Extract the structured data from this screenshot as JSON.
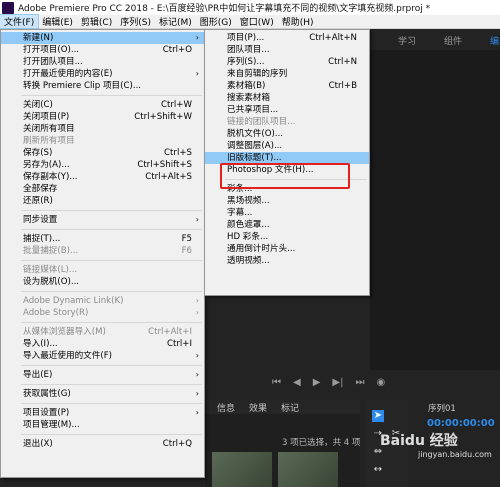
{
  "window": {
    "title": "Adobe Premiere Pro CC 2018 - E:\\百度经验\\PR中如何让字幕填充不同的视频\\文字填充视频.prproj *"
  },
  "menubar": [
    {
      "label": "文件(F)",
      "active": true
    },
    {
      "label": "编辑(E)"
    },
    {
      "label": "剪辑(C)"
    },
    {
      "label": "序列(S)"
    },
    {
      "label": "标记(M)"
    },
    {
      "label": "图形(G)"
    },
    {
      "label": "窗口(W)"
    },
    {
      "label": "帮助(H)"
    }
  ],
  "workspace_tabs": [
    "学习",
    "组件",
    "编"
  ],
  "file_menu": [
    {
      "label": "新建(N)",
      "arrow": true,
      "highlighted": true
    },
    {
      "label": "打开项目(O)...",
      "shortcut": "Ctrl+O"
    },
    {
      "label": "打开团队项目..."
    },
    {
      "label": "打开最近使用的内容(E)",
      "arrow": true
    },
    {
      "label": "转换 Premiere Clip 项目(C)..."
    },
    {
      "sep": true
    },
    {
      "label": "关闭(C)",
      "shortcut": "Ctrl+W"
    },
    {
      "label": "关闭项目(P)",
      "shortcut": "Ctrl+Shift+W"
    },
    {
      "label": "关闭所有项目"
    },
    {
      "label": "刷新所有项目",
      "disabled": true
    },
    {
      "label": "保存(S)",
      "shortcut": "Ctrl+S"
    },
    {
      "label": "另存为(A)...",
      "shortcut": "Ctrl+Shift+S"
    },
    {
      "label": "保存副本(Y)...",
      "shortcut": "Ctrl+Alt+S"
    },
    {
      "label": "全部保存"
    },
    {
      "label": "还原(R)"
    },
    {
      "sep": true
    },
    {
      "label": "同步设置",
      "arrow": true
    },
    {
      "sep": true
    },
    {
      "label": "捕捉(T)...",
      "shortcut": "F5"
    },
    {
      "label": "批量捕捉(B)...",
      "shortcut": "F6",
      "disabled": true
    },
    {
      "sep": true
    },
    {
      "label": "链接媒体(L)...",
      "disabled": true
    },
    {
      "label": "设为脱机(O)..."
    },
    {
      "sep": true
    },
    {
      "label": "Adobe Dynamic Link(K)",
      "arrow": true,
      "disabled": true
    },
    {
      "label": "Adobe Story(R)",
      "arrow": true,
      "disabled": true
    },
    {
      "sep": true
    },
    {
      "label": "从媒体浏览器导入(M)",
      "shortcut": "Ctrl+Alt+I",
      "disabled": true
    },
    {
      "label": "导入(I)...",
      "shortcut": "Ctrl+I"
    },
    {
      "label": "导入最近使用的文件(F)",
      "arrow": true
    },
    {
      "sep": true
    },
    {
      "label": "导出(E)",
      "arrow": true
    },
    {
      "sep": true
    },
    {
      "label": "获取属性(G)",
      "arrow": true
    },
    {
      "sep": true
    },
    {
      "label": "项目设置(P)",
      "arrow": true
    },
    {
      "label": "项目管理(M)..."
    },
    {
      "sep": true
    },
    {
      "label": "退出(X)",
      "shortcut": "Ctrl+Q"
    }
  ],
  "new_submenu": [
    {
      "label": "项目(P)...",
      "shortcut": "Ctrl+Alt+N"
    },
    {
      "label": "团队项目..."
    },
    {
      "label": "序列(S)...",
      "shortcut": "Ctrl+N"
    },
    {
      "label": "来自剪辑的序列"
    },
    {
      "label": "素材箱(B)",
      "shortcut": "Ctrl+B"
    },
    {
      "label": "搜索素材箱"
    },
    {
      "label": "已共享项目..."
    },
    {
      "label": "链接的团队项目...",
      "disabled": true
    },
    {
      "label": "脱机文件(O)..."
    },
    {
      "label": "调整图层(A)..."
    },
    {
      "label": "旧版标题(T)...",
      "highlighted": true
    },
    {
      "label": "Photoshop 文件(H)..."
    },
    {
      "sep": true
    },
    {
      "label": "彩条..."
    },
    {
      "label": "黑场视频..."
    },
    {
      "label": "字幕..."
    },
    {
      "label": "颜色遮罩..."
    },
    {
      "label": "HD 彩条..."
    },
    {
      "label": "通用倒计时片头..."
    },
    {
      "label": "透明视频..."
    }
  ],
  "project_panel": {
    "tabs": [
      "信息",
      "效果",
      "标记"
    ],
    "selection_text": "3 项已选择，共 4 项"
  },
  "sequence_panel": {
    "title": "序列01",
    "timecode": "00:00:00:00"
  },
  "watermark": {
    "main": "Baidu 经验",
    "sub": "jingyan.baidu.com"
  }
}
